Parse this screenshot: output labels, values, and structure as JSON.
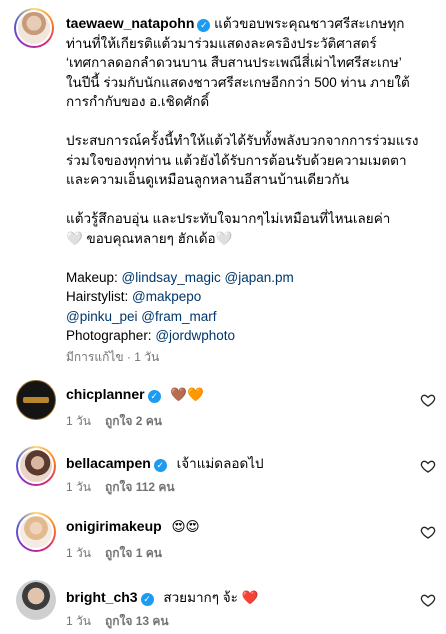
{
  "post": {
    "username": "taewaew_natapohn",
    "verified_icon": "verified-badge-icon",
    "caption_lines": [
      "แต้วขอบพระคุณชาวศรีสะเกษทุก",
      "ท่านที่ให้เกียรติแต้วมาร่วมแสดงละครอิงประวัติศาสตร์",
      "‘เทศกาลดอกลำดวนบาน สืบสานประเพณีสี่เผ่าไทศรีสะเกษ’",
      "ในปีนี้ ร่วมกับนักแสดงชาวศรีสะเกษอีกกว่า 500 ท่าน ภายใต้",
      "การกำกับของ อ.เชิดศักดิ์",
      "",
      "ประสบการณ์ครั้งนี้ทำให้แต้วได้รับทั้งพลังบวกจากการร่วมแรง",
      "ร่วมใจของทุกท่าน แต้วยังได้รับการต้อนรับด้วยความเมตตา",
      "และความเอ็นดูเหมือนลูกหลานอีสานบ้านเดียวกัน",
      "",
      "แต้วรู้สึกอบอุ่น และประทับใจมากๆไม่เหมือนที่ไหนเลยค่า",
      "🤍 ขอบคุณหลายๆ ฮักเด้อ🤍",
      ""
    ],
    "credits": {
      "makeup_label": "Makeup: ",
      "makeup_mentions": [
        "@lindsay_magic",
        "@japan.pm"
      ],
      "hair_label": "Hairstylist: ",
      "hair_mentions": [
        "@makpepo"
      ],
      "extra_mentions": [
        "@pinku_pei",
        "@fram_marf"
      ],
      "photo_label": "Photographer: ",
      "photo_mentions": [
        "@jordwphoto"
      ]
    },
    "edited_meta": "มีการแก้ไข · 1 วัน"
  },
  "comments": [
    {
      "username": "chicplanner",
      "verified": true,
      "text": "🤎🧡",
      "time": "1 วัน",
      "likes": "ถูกใจ 2 คน",
      "avatar_color": "#1a1a1a"
    },
    {
      "username": "bellacampen",
      "verified": true,
      "text": "เจ้าแม่ดลอดไป",
      "time": "1 วัน",
      "likes": "ถูกใจ 112 คน",
      "avatar_color": "#c9a48c"
    },
    {
      "username": "onigirimakeup",
      "verified": false,
      "text": "😍😍",
      "time": "1 วัน",
      "likes": "ถูกใจ 1 คน",
      "avatar_color": "#d8b89a"
    },
    {
      "username": "bright_ch3",
      "verified": true,
      "text": "สวยมากๆ จ้ะ ❤️",
      "time": "1 วัน",
      "likes": "ถูกใจ 13 คน",
      "avatar_color": "#b7b7b7"
    }
  ],
  "colors": {
    "link": "#00376b",
    "meta": "#737373",
    "verified": "#1d9bf0"
  }
}
